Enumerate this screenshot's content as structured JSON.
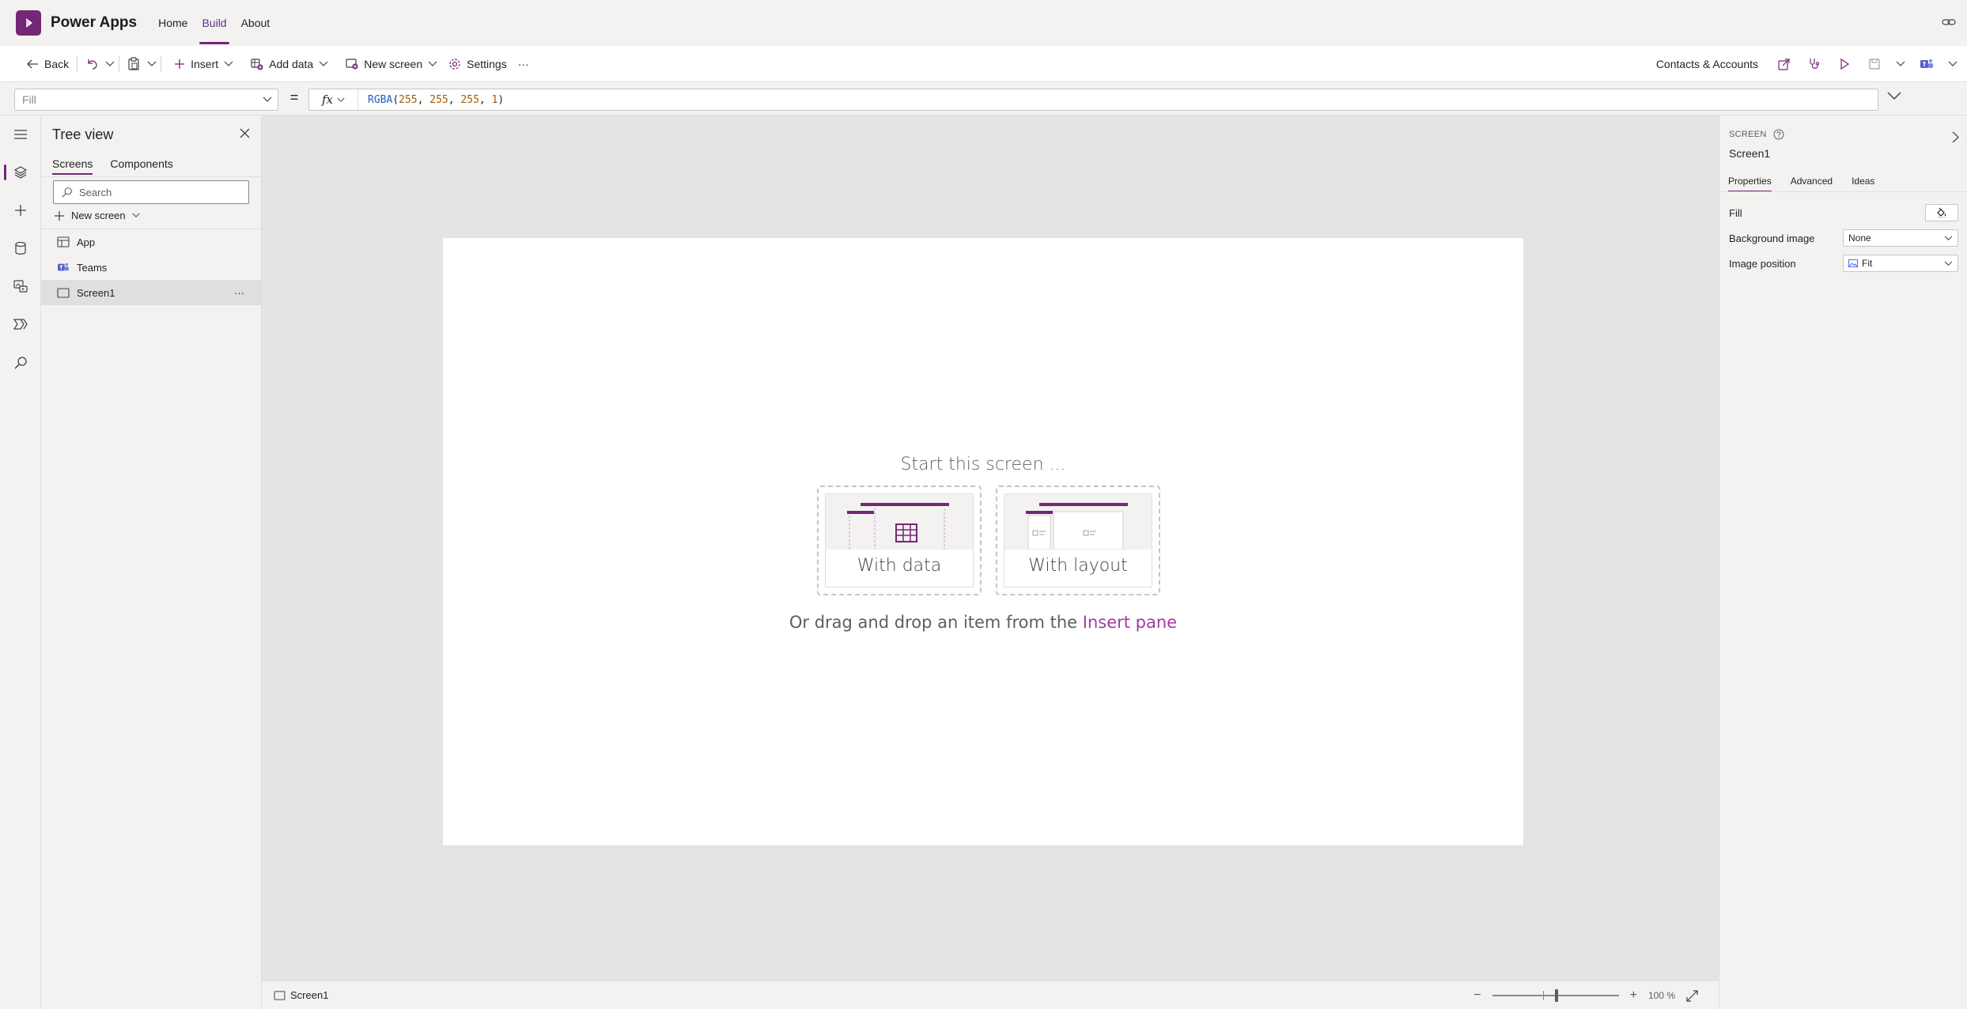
{
  "header": {
    "app_name": "Power Apps",
    "nav": [
      {
        "label": "Home"
      },
      {
        "label": "Build",
        "active": true
      },
      {
        "label": "About"
      }
    ],
    "brand_color": "#742774"
  },
  "cmdbar": {
    "back": "Back",
    "insert": "Insert",
    "add_data": "Add data",
    "new_screen": "New screen",
    "settings": "Settings",
    "more": "···",
    "app_title": "Contacts & Accounts"
  },
  "formula": {
    "property": "Fill",
    "equals": "=",
    "fx": "fx",
    "fn": "RGBA",
    "open": "(",
    "args": [
      "255",
      "255",
      "255",
      "1"
    ],
    "comma": ", ",
    "close": ")"
  },
  "tree": {
    "title": "Tree view",
    "tabs": [
      "Screens",
      "Components"
    ],
    "search_placeholder": "Search",
    "new_screen": "New screen",
    "items": [
      {
        "label": "App",
        "icon": "app-icon"
      },
      {
        "label": "Teams",
        "icon": "teams-icon"
      },
      {
        "label": "Screen1",
        "icon": "screen-icon",
        "selected": true
      }
    ],
    "more": "···"
  },
  "canvas": {
    "start_title": "Start this screen ...",
    "with_data": "With data",
    "with_layout": "With layout",
    "drag_prefix": "Or drag and drop an item from the",
    "drag_link": "Insert pane"
  },
  "status": {
    "screen": "Screen1",
    "zoom": "100 %",
    "zoom_out": "−",
    "zoom_in": "+"
  },
  "props": {
    "type": "SCREEN",
    "name": "Screen1",
    "tabs": [
      "Properties",
      "Advanced",
      "Ideas"
    ],
    "fill_label": "Fill",
    "bg_label": "Background image",
    "bg_value": "None",
    "pos_label": "Image position",
    "pos_value": "Fit"
  }
}
